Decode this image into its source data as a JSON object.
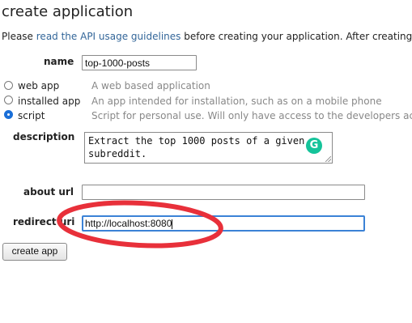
{
  "page": {
    "title": "create application",
    "intro_before": "Please ",
    "intro_link": "read the API usage guidelines",
    "intro_after": " before creating your application. After creating"
  },
  "form": {
    "name_label": "name",
    "name_value": "top-1000-posts",
    "app_types": [
      {
        "label": "web app",
        "description": "A web based application",
        "checked": false
      },
      {
        "label": "installed app",
        "description": "An app intended for installation, such as on a mobile phone",
        "checked": false
      },
      {
        "label": "script",
        "description": "Script for personal use. Will only have access to the developers ac",
        "checked": true
      }
    ],
    "description_label": "description",
    "description_line1": "Extract the top 1000 posts of a given",
    "description_line2": "subreddit.",
    "about_url_label": "about url",
    "about_url_value": "",
    "redirect_uri_label": "redirect uri",
    "redirect_uri_value": "http://localhost:8080",
    "submit_label": "create app"
  },
  "icons": {
    "grammarly": "grammarly-icon",
    "grammarly_glyph": "G"
  },
  "annotation": {
    "color": "#e8303a",
    "shape": "ellipse"
  }
}
